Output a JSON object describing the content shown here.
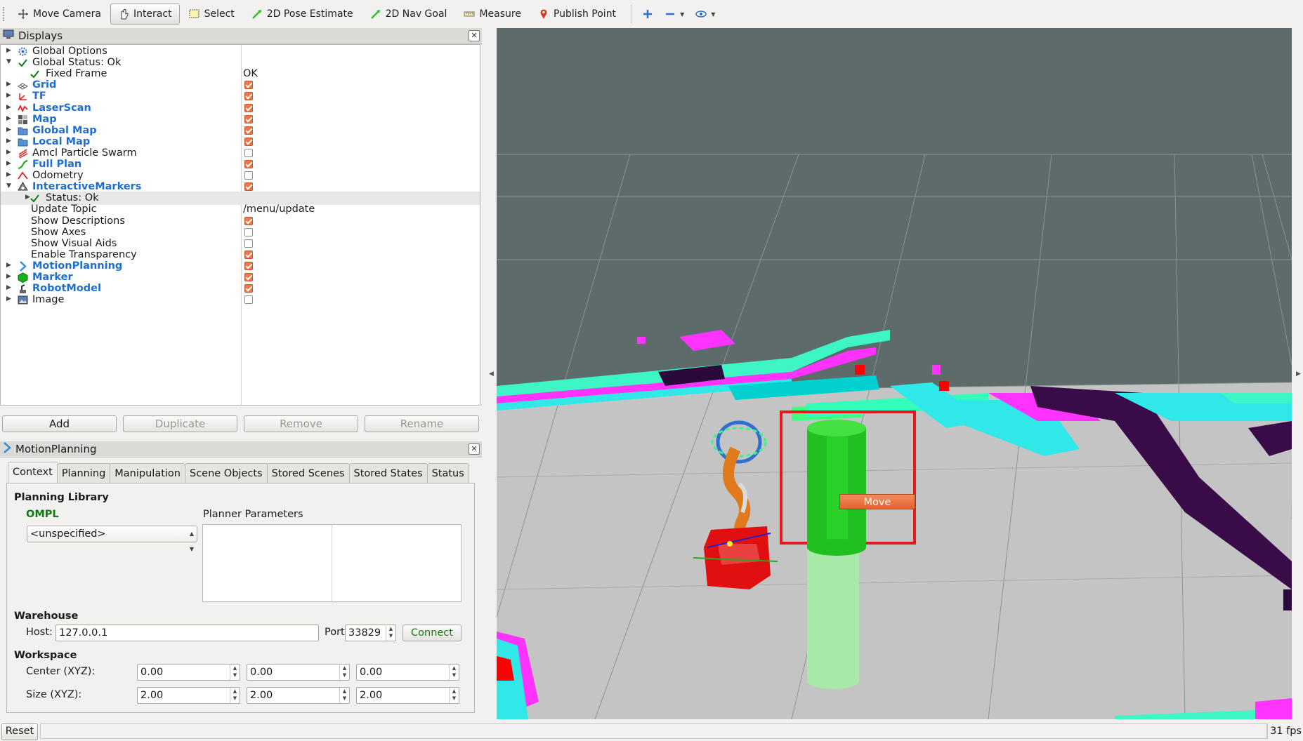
{
  "toolbar": {
    "items": [
      {
        "label": "Move Camera",
        "icon": "move-camera-icon"
      },
      {
        "label": "Interact",
        "icon": "hand-cursor-icon",
        "active": true
      },
      {
        "label": "Select",
        "icon": "select-box-icon"
      },
      {
        "label": "2D Pose Estimate",
        "icon": "green-arrow-icon"
      },
      {
        "label": "2D Nav Goal",
        "icon": "green-arrow-icon"
      },
      {
        "label": "Measure",
        "icon": "ruler-icon"
      },
      {
        "label": "Publish Point",
        "icon": "map-pin-icon"
      }
    ],
    "extra_icons": [
      "plus-icon",
      "minus-icon",
      "eye-icon"
    ]
  },
  "displays": {
    "title": "Displays",
    "rows": [
      {
        "label": "Global Options",
        "icon": "gear-icon",
        "expand": "collapsed",
        "indent": 0
      },
      {
        "label": "Global Status: Ok",
        "icon": "check-icon",
        "expand": "expanded",
        "indent": 0
      },
      {
        "label": "Fixed Frame",
        "icon": "check-icon",
        "indent": 1,
        "value": "OK"
      },
      {
        "label": "Grid",
        "icon": "grid-icon",
        "expand": "collapsed",
        "blue": true,
        "checked": true
      },
      {
        "label": "TF",
        "icon": "tf-axes-icon",
        "expand": "collapsed",
        "blue": true,
        "checked": true
      },
      {
        "label": "LaserScan",
        "icon": "laser-scan-icon",
        "expand": "collapsed",
        "blue": true,
        "checked": true
      },
      {
        "label": "Map",
        "icon": "map-icon",
        "expand": "collapsed",
        "blue": true,
        "checked": true
      },
      {
        "label": "Global Map",
        "icon": "folder-icon",
        "expand": "collapsed",
        "blue": true,
        "checked": true
      },
      {
        "label": "Local Map",
        "icon": "folder-icon",
        "expand": "collapsed",
        "blue": true,
        "checked": true
      },
      {
        "label": "Amcl Particle Swarm",
        "icon": "particle-swarm-icon",
        "expand": "collapsed",
        "checked": false
      },
      {
        "label": "Full Plan",
        "icon": "path-icon",
        "expand": "collapsed",
        "blue": true,
        "checked": true
      },
      {
        "label": "Odometry",
        "icon": "odometry-icon",
        "expand": "collapsed",
        "checked": false
      },
      {
        "label": "InteractiveMarkers",
        "icon": "interactive-markers-icon",
        "expand": "expanded",
        "blue": true,
        "checked": true
      },
      {
        "label": "Status: Ok",
        "icon": "check-icon",
        "expand": "collapsed",
        "indent": 1,
        "selected": true
      },
      {
        "label": "Update Topic",
        "indent": 1,
        "value": "/menu/update"
      },
      {
        "label": "Show Descriptions",
        "indent": 1,
        "checked": true
      },
      {
        "label": "Show Axes",
        "indent": 1,
        "checked": false
      },
      {
        "label": "Show Visual Aids",
        "indent": 1,
        "checked": false
      },
      {
        "label": "Enable Transparency",
        "indent": 1,
        "checked": true
      },
      {
        "label": "MotionPlanning",
        "icon": "motion-planning-icon",
        "expand": "collapsed",
        "blue": true,
        "checked": true
      },
      {
        "label": "Marker",
        "icon": "marker-cube-icon",
        "expand": "collapsed",
        "blue": true,
        "checked": true
      },
      {
        "label": "RobotModel",
        "icon": "robot-model-icon",
        "expand": "collapsed",
        "blue": true,
        "checked": true
      },
      {
        "label": "Image",
        "icon": "image-icon",
        "expand": "collapsed",
        "checked": false
      }
    ],
    "buttons": {
      "add": "Add",
      "duplicate": "Duplicate",
      "remove": "Remove",
      "rename": "Rename"
    }
  },
  "motion_planning": {
    "title": "MotionPlanning",
    "tabs": [
      "Context",
      "Planning",
      "Manipulation",
      "Scene Objects",
      "Stored Scenes",
      "Stored States",
      "Status"
    ],
    "active_tab": "Context",
    "planning_library_label": "Planning Library",
    "library_name": "OMPL",
    "planner_select": "<unspecified>",
    "planner_parameters_label": "Planner Parameters",
    "warehouse_label": "Warehouse",
    "host_label": "Host:",
    "host_value": "127.0.0.1",
    "port_label": "Port:",
    "port_value": "33829",
    "connect_label": "Connect",
    "workspace_label": "Workspace",
    "center_label": "Center (XYZ):",
    "center_values": [
      "0.00",
      "0.00",
      "0.00"
    ],
    "size_label": "Size (XYZ):",
    "size_values": [
      "2.00",
      "2.00",
      "2.00"
    ]
  },
  "viewport": {
    "menu_button": "Move",
    "grid_color": "#c9c9c9",
    "sky_color": "#5d6b6b",
    "highlight_color": "#e41a1a"
  },
  "statusbar": {
    "reset_label": "Reset",
    "fps": "31 fps"
  }
}
